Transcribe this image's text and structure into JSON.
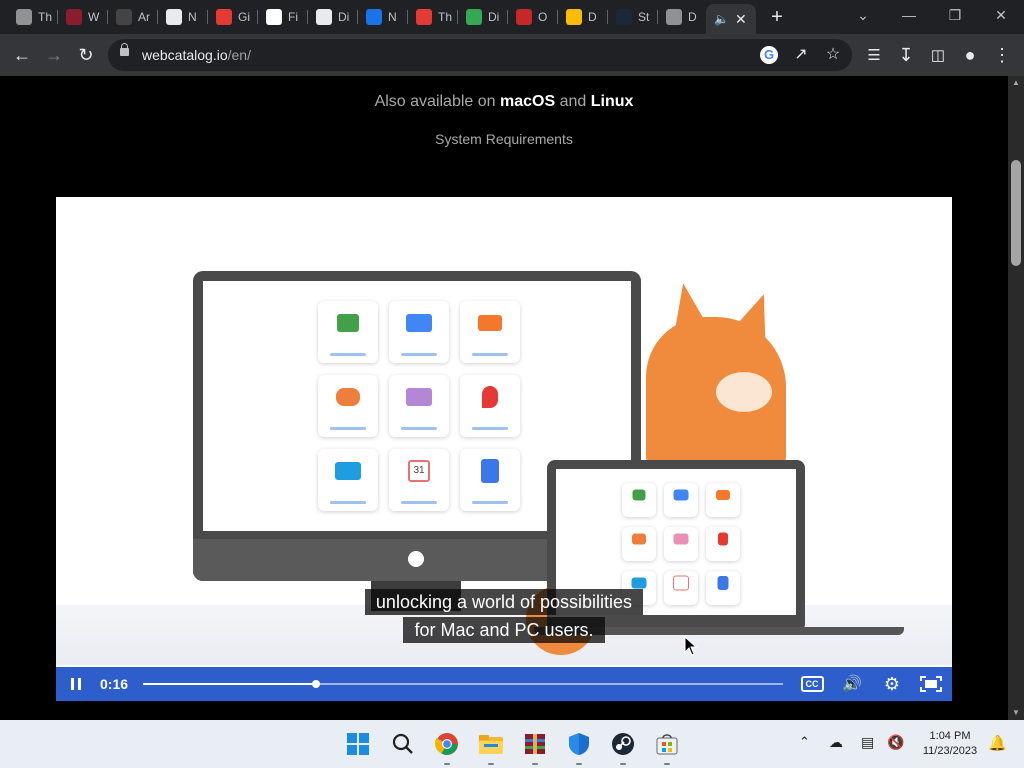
{
  "browser": {
    "tabs": [
      {
        "label": "Th",
        "icon": "globe-icon",
        "color": "#8f9193"
      },
      {
        "label": "W",
        "icon": "winrar-icon",
        "color": "#8b1c2c"
      },
      {
        "label": "Ar",
        "icon": "avatar-icon",
        "color": "#444"
      },
      {
        "label": "N",
        "icon": "github-icon",
        "color": "#e8eaed"
      },
      {
        "label": "Gi",
        "icon": "pacman-ghost-icon",
        "color": "#e53935"
      },
      {
        "label": "Fi",
        "icon": "google-icon",
        "color": "#ffffff"
      },
      {
        "label": "Di",
        "icon": "download-icon",
        "color": "#e8eaed"
      },
      {
        "label": "N",
        "icon": "app-icon",
        "color": "#1a73e8"
      },
      {
        "label": "Th",
        "icon": "record-icon",
        "color": "#e53935"
      },
      {
        "label": "Di",
        "icon": "checkmark-icon",
        "color": "#34a853"
      },
      {
        "label": "O",
        "icon": "r-logo-icon",
        "color": "#c62828"
      },
      {
        "label": "D",
        "icon": "pen-icon",
        "color": "#fbbc04"
      },
      {
        "label": "St",
        "icon": "steam-icon",
        "color": "#1b2838"
      },
      {
        "label": "D",
        "icon": "globe-icon",
        "color": "#8f9193"
      }
    ],
    "active_tab_icon": "speaker-icon",
    "url_host": "webcatalog.io",
    "url_path": "/en/",
    "new_tab_label": "+"
  },
  "page": {
    "available_prefix": "Also available on",
    "available_os1": "macOS",
    "available_and": "and",
    "available_os2": "Linux",
    "system_requirements": "System Requirements"
  },
  "video": {
    "caption_line1": "unlocking a world of possibilities",
    "caption_line2": "for Mac and PC users.",
    "time": "0:16",
    "progress_fraction": 0.27,
    "state": "playing"
  },
  "colors": {
    "player_bar": "#2d5ecb",
    "page_bg": "#000000"
  },
  "taskbar": {
    "apps": [
      "windows-start-icon",
      "search-icon",
      "chrome-icon",
      "file-explorer-icon",
      "winrar-icon",
      "windows-security-icon",
      "steam-icon",
      "microsoft-store-icon"
    ],
    "time": "1:04 PM",
    "date": "11/23/2023"
  }
}
